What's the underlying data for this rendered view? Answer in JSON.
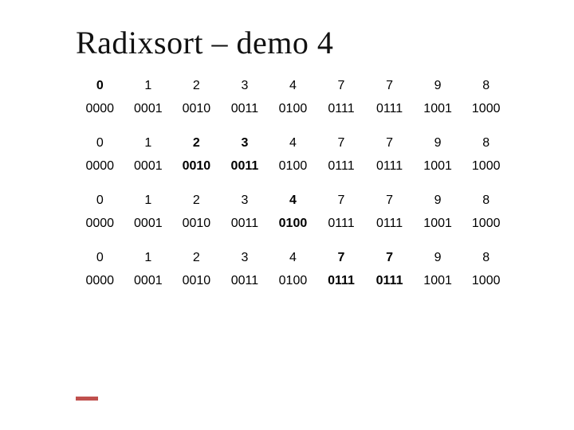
{
  "title": "Radixsort – demo 4",
  "rows": [
    {
      "kind": "idx",
      "bold": [
        0
      ],
      "cells": [
        "0",
        "1",
        "2",
        "3",
        "4",
        "7",
        "7",
        "9",
        "8"
      ]
    },
    {
      "kind": "bin",
      "bold": [],
      "cells": [
        "0000",
        "0001",
        "0010",
        "0011",
        "0100",
        "0111",
        "0111",
        "1001",
        "1000"
      ]
    },
    {
      "kind": "spacer"
    },
    {
      "kind": "idx",
      "bold": [
        2,
        3
      ],
      "cells": [
        "0",
        "1",
        "2",
        "3",
        "4",
        "7",
        "7",
        "9",
        "8"
      ]
    },
    {
      "kind": "bin",
      "bold": [
        2,
        3
      ],
      "cells": [
        "0000",
        "0001",
        "0010",
        "0011",
        "0100",
        "0111",
        "0111",
        "1001",
        "1000"
      ]
    },
    {
      "kind": "spacer"
    },
    {
      "kind": "idx",
      "bold": [
        4
      ],
      "cells": [
        "0",
        "1",
        "2",
        "3",
        "4",
        "7",
        "7",
        "9",
        "8"
      ]
    },
    {
      "kind": "bin",
      "bold": [
        4
      ],
      "cells": [
        "0000",
        "0001",
        "0010",
        "0011",
        "0100",
        "0111",
        "0111",
        "1001",
        "1000"
      ]
    },
    {
      "kind": "spacer"
    },
    {
      "kind": "idx",
      "bold": [
        5,
        6
      ],
      "cells": [
        "0",
        "1",
        "2",
        "3",
        "4",
        "7",
        "7",
        "9",
        "8"
      ]
    },
    {
      "kind": "bin",
      "bold": [
        5,
        6
      ],
      "cells": [
        "0000",
        "0001",
        "0010",
        "0011",
        "0100",
        "0111",
        "0111",
        "1001",
        "1000"
      ]
    }
  ]
}
